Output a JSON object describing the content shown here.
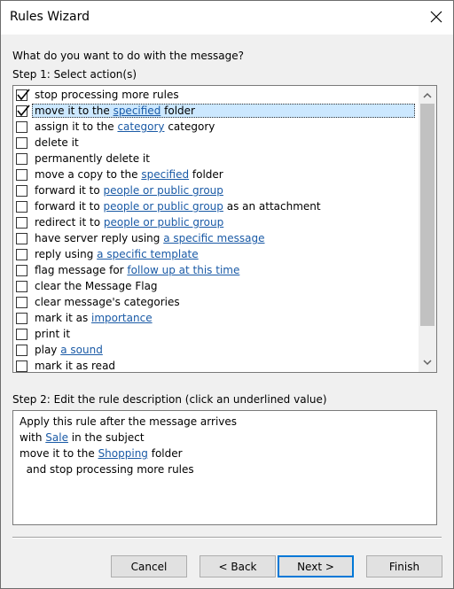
{
  "window": {
    "title": "Rules Wizard"
  },
  "prompt": "What do you want to do with the message?",
  "step1_label": "Step 1: Select action(s)",
  "actions": [
    {
      "checked": true,
      "selected": false,
      "parts": [
        {
          "t": "stop processing more rules"
        }
      ]
    },
    {
      "checked": true,
      "selected": true,
      "parts": [
        {
          "t": "move it to the "
        },
        {
          "t": "specified",
          "link": true
        },
        {
          "t": " folder"
        }
      ]
    },
    {
      "checked": false,
      "selected": false,
      "parts": [
        {
          "t": "assign it to the "
        },
        {
          "t": "category",
          "link": true
        },
        {
          "t": " category"
        }
      ]
    },
    {
      "checked": false,
      "selected": false,
      "parts": [
        {
          "t": "delete it"
        }
      ]
    },
    {
      "checked": false,
      "selected": false,
      "parts": [
        {
          "t": "permanently delete it"
        }
      ]
    },
    {
      "checked": false,
      "selected": false,
      "parts": [
        {
          "t": "move a copy to the "
        },
        {
          "t": "specified",
          "link": true
        },
        {
          "t": " folder"
        }
      ]
    },
    {
      "checked": false,
      "selected": false,
      "parts": [
        {
          "t": "forward it to "
        },
        {
          "t": "people or public group",
          "link": true
        }
      ]
    },
    {
      "checked": false,
      "selected": false,
      "parts": [
        {
          "t": "forward it to "
        },
        {
          "t": "people or public group",
          "link": true
        },
        {
          "t": " as an attachment"
        }
      ]
    },
    {
      "checked": false,
      "selected": false,
      "parts": [
        {
          "t": "redirect it to "
        },
        {
          "t": "people or public group",
          "link": true
        }
      ]
    },
    {
      "checked": false,
      "selected": false,
      "parts": [
        {
          "t": "have server reply using "
        },
        {
          "t": "a specific message",
          "link": true
        }
      ]
    },
    {
      "checked": false,
      "selected": false,
      "parts": [
        {
          "t": "reply using "
        },
        {
          "t": "a specific template",
          "link": true
        }
      ]
    },
    {
      "checked": false,
      "selected": false,
      "parts": [
        {
          "t": "flag message for "
        },
        {
          "t": "follow up at this time",
          "link": true
        }
      ]
    },
    {
      "checked": false,
      "selected": false,
      "parts": [
        {
          "t": "clear the Message Flag"
        }
      ]
    },
    {
      "checked": false,
      "selected": false,
      "parts": [
        {
          "t": "clear message's categories"
        }
      ]
    },
    {
      "checked": false,
      "selected": false,
      "parts": [
        {
          "t": "mark it as "
        },
        {
          "t": "importance",
          "link": true
        }
      ]
    },
    {
      "checked": false,
      "selected": false,
      "parts": [
        {
          "t": "print it"
        }
      ]
    },
    {
      "checked": false,
      "selected": false,
      "parts": [
        {
          "t": "play "
        },
        {
          "t": "a sound",
          "link": true
        }
      ]
    },
    {
      "checked": false,
      "selected": false,
      "parts": [
        {
          "t": "mark it as read"
        }
      ]
    }
  ],
  "step2_label": "Step 2: Edit the rule description (click an underlined value)",
  "description": [
    [
      {
        "t": "Apply this rule after the message arrives"
      }
    ],
    [
      {
        "t": "with "
      },
      {
        "t": "Sale",
        "link": true
      },
      {
        "t": " in the subject"
      }
    ],
    [
      {
        "t": "move it to the "
      },
      {
        "t": "Shopping",
        "link": true
      },
      {
        "t": " folder"
      }
    ],
    [
      {
        "t": "  and stop processing more rules"
      }
    ]
  ],
  "buttons": {
    "cancel": "Cancel",
    "back": "< Back",
    "next": "Next >",
    "finish": "Finish"
  },
  "colors": {
    "link": "#1a5aa6",
    "selection": "#cce8ff",
    "default_border": "#0078d7"
  }
}
